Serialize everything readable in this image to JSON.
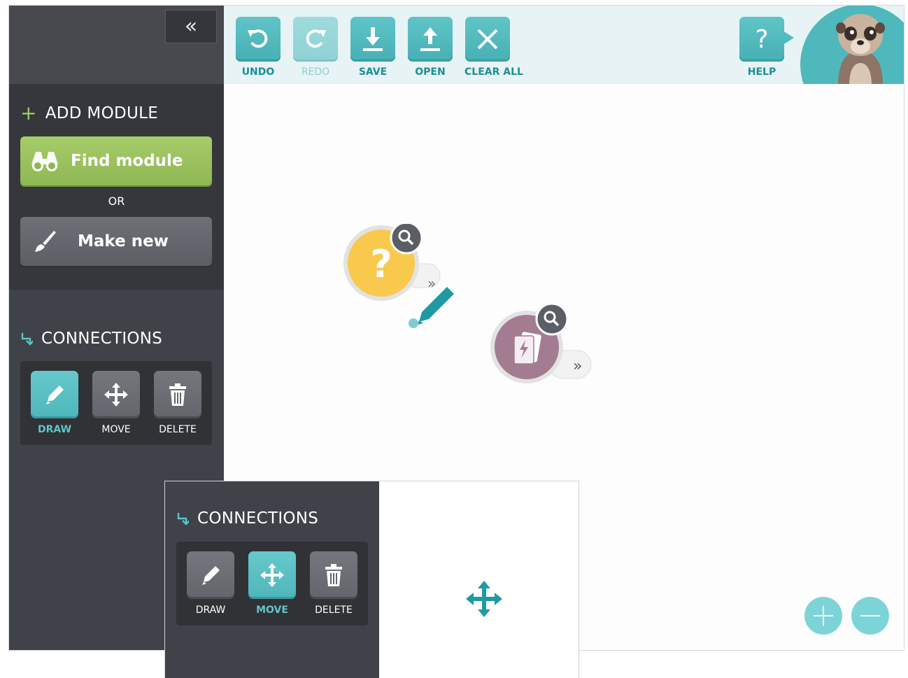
{
  "sidebar": {
    "collapse_glyph": "«",
    "add_module": {
      "title": "ADD MODULE",
      "find_label": "Find module",
      "or_label": "OR",
      "make_label": "Make new"
    },
    "connections": {
      "title": "CONNECTIONS",
      "tools": [
        {
          "label": "DRAW",
          "icon": "pencil-icon",
          "active": true
        },
        {
          "label": "MOVE",
          "icon": "move-arrows-icon",
          "active": false
        },
        {
          "label": "DELETE",
          "icon": "trash-icon",
          "active": false
        }
      ]
    }
  },
  "toolbar": {
    "buttons": [
      {
        "label": "UNDO",
        "icon": "undo-icon",
        "enabled": true
      },
      {
        "label": "REDO",
        "icon": "redo-icon",
        "enabled": false
      },
      {
        "label": "SAVE",
        "icon": "download-icon",
        "enabled": true
      },
      {
        "label": "OPEN",
        "icon": "upload-icon",
        "enabled": true
      },
      {
        "label": "CLEAR ALL",
        "icon": "close-icon",
        "enabled": true
      }
    ],
    "help": {
      "label": "HELP",
      "glyph": "?"
    }
  },
  "canvas": {
    "nodes": [
      {
        "kind": "unknown-module",
        "glyph": "?",
        "color": "#f9c94e",
        "output_glyph": "»"
      },
      {
        "kind": "trigger-module",
        "icon": "lightning-card-icon",
        "color": "#a47c92",
        "output_glyph": "»"
      }
    ],
    "zoom": {
      "in_icon": "plus-icon",
      "out_icon": "minus-icon"
    }
  },
  "inset_panel": {
    "connections_title": "CONNECTIONS",
    "tools": [
      {
        "label": "DRAW",
        "icon": "pencil-icon",
        "active": false
      },
      {
        "label": "MOVE",
        "icon": "move-arrows-icon",
        "active": true
      },
      {
        "label": "DELETE",
        "icon": "trash-icon",
        "active": false
      }
    ]
  },
  "colors": {
    "accent": "#4fb8bc",
    "sidebar_bg": "#3f4248",
    "find_button": "#9bc25f",
    "toolbar_bg": "#e7f3f4"
  }
}
